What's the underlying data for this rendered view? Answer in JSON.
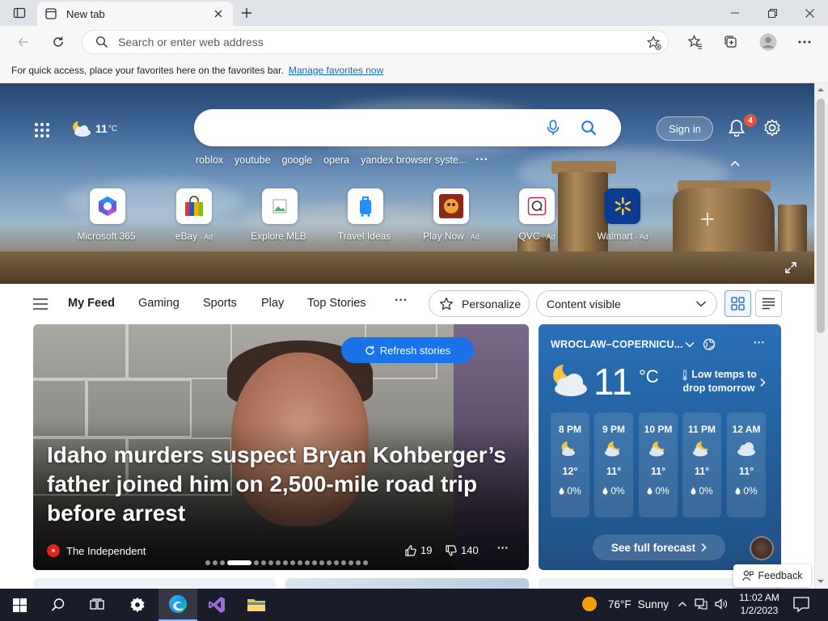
{
  "browser": {
    "tab_title": "New tab",
    "address_placeholder": "Search or enter web address",
    "favorites_message": "For quick access, place your favorites here on the favorites bar.",
    "favorites_link": "Manage favorites now"
  },
  "hero": {
    "weather_temp": "11",
    "weather_unit": "°C",
    "search_value": "",
    "trending": [
      "roblox",
      "youtube",
      "google",
      "opera",
      "yandex browser syste..."
    ],
    "trending_more": "···",
    "sign_in": "Sign in",
    "notifications_count": "4",
    "tiles": [
      {
        "label": "Microsoft 365",
        "ad": ""
      },
      {
        "label": "eBay",
        "ad": "· Ad"
      },
      {
        "label": "Explore MLB",
        "ad": ""
      },
      {
        "label": "Travel Ideas",
        "ad": ""
      },
      {
        "label": "Play Now",
        "ad": "· Ad"
      },
      {
        "label": "QVC",
        "ad": "· Ad"
      },
      {
        "label": "Walmart",
        "ad": "· Ad"
      }
    ]
  },
  "feed": {
    "tabs": [
      "My Feed",
      "Gaming",
      "Sports",
      "Play",
      "Top Stories"
    ],
    "more": "···",
    "personalize": "Personalize",
    "content_visibility": "Content visible"
  },
  "story": {
    "refresh": "Refresh stories",
    "headline": "Idaho murders suspect Bryan Kohberger’s father joined him on 2,500-mile road trip before arrest",
    "source": "The Independent",
    "likes": "19",
    "dislikes": "140",
    "more": "···"
  },
  "weather": {
    "location": "WROCLAW–COPERNICU...",
    "temp": "11",
    "unit": "°C",
    "alert": "Low temps to drop tomorrow",
    "more": "···",
    "hours": [
      {
        "time": "8 PM",
        "temp": "12°",
        "precip": "0%"
      },
      {
        "time": "9 PM",
        "temp": "11°",
        "precip": "0%"
      },
      {
        "time": "10 PM",
        "temp": "11°",
        "precip": "0%"
      },
      {
        "time": "11 PM",
        "temp": "11°",
        "precip": "0%"
      },
      {
        "time": "12 AM",
        "temp": "11°",
        "precip": "0%"
      }
    ],
    "forecast_button": "See full forecast"
  },
  "feedback": "Feedback",
  "taskbar": {
    "weather_temp": "76°F",
    "weather_condition": "Sunny",
    "time": "11:02 AM",
    "date": "1/2/2023"
  },
  "colors": {
    "accent": "#1a73e8",
    "taskbar": "#1b1c2a",
    "badge": "#e0533f"
  }
}
